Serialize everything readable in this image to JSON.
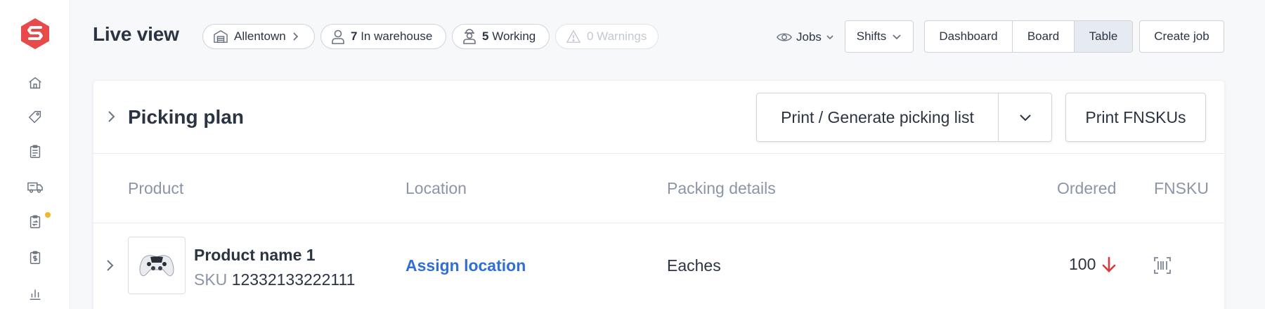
{
  "header": {
    "title": "Live view",
    "pills": {
      "location": "Allentown",
      "in_warehouse_count": "7",
      "in_warehouse_label": "In warehouse",
      "working_count": "5",
      "working_label": "Working",
      "warnings": "0 Warnings"
    },
    "jobs_label": "Jobs",
    "shifts_label": "Shifts",
    "views": [
      "Dashboard",
      "Board",
      "Table"
    ],
    "active_view": "Table",
    "create_job_label": "Create job"
  },
  "sidebar": {
    "items": [
      {
        "icon": "home-icon"
      },
      {
        "icon": "tag-icon"
      },
      {
        "icon": "clipboard-icon"
      },
      {
        "icon": "truck-icon"
      },
      {
        "icon": "clipboard-return-icon",
        "has_notification": true
      },
      {
        "icon": "clipboard-dollar-icon"
      },
      {
        "icon": "bar-chart-icon"
      }
    ],
    "notification_color": "#f5b529"
  },
  "card": {
    "title": "Picking plan",
    "print_label": "Print / Generate picking list",
    "print_fnsku_label": "Print FNSKUs",
    "columns": [
      "Product",
      "Location",
      "Packing details",
      "Ordered",
      "FNSKU"
    ],
    "rows": [
      {
        "product_name": "Product name 1",
        "sku_label": "SKU",
        "sku": "12332133222111",
        "location": "Assign location",
        "packing": "Eaches",
        "ordered": "100"
      }
    ]
  },
  "colors": {
    "brand": "#e84a4a",
    "link": "#2f6fd6",
    "alert_arrow": "#d93b3b"
  }
}
